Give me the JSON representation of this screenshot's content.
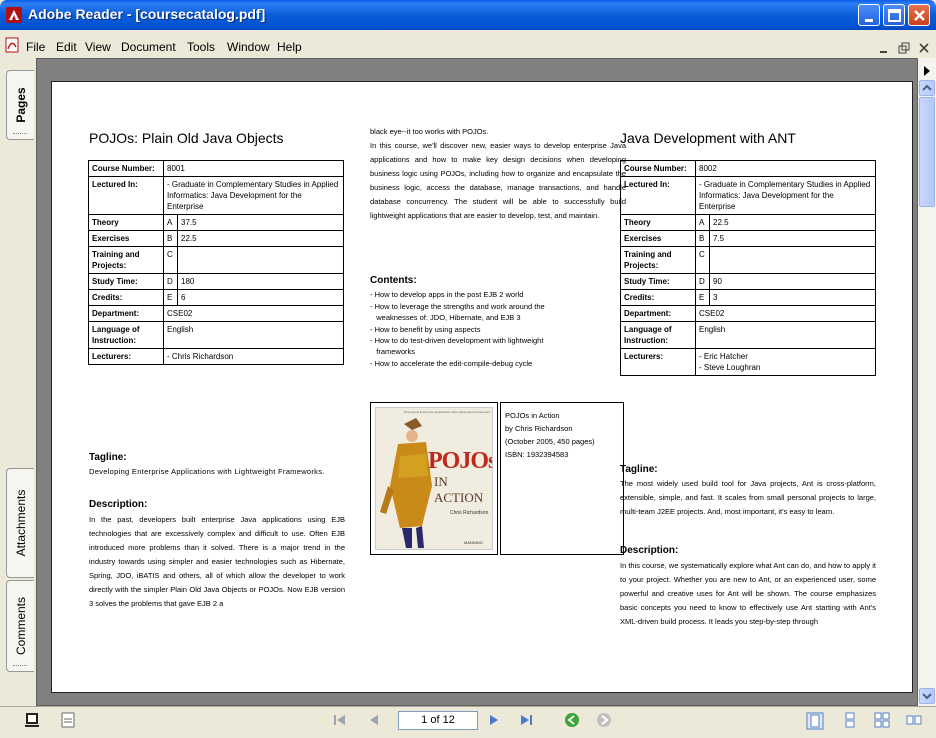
{
  "window": {
    "title": "Adobe Reader - [coursecatalog.pdf]"
  },
  "menu": [
    "File",
    "Edit",
    "View",
    "Document",
    "Tools",
    "Window",
    "Help"
  ],
  "side_tabs": {
    "pages": "Pages",
    "attachments": "Attachments",
    "comments": "Comments"
  },
  "doc": {
    "left": {
      "title": "POJOs: Plain Old Java Objects",
      "table": {
        "course_number_label": "Course Number:",
        "course_number": "8001",
        "lectured_in_label": "Lectured In:",
        "lectured_in": "- Graduate in Complementary Studies in Applied Informatics: Java Development for the Enterprise",
        "theory_label": "Theory",
        "theory_letter": "A",
        "theory_value": "37.5",
        "exercises_label": "Exercises",
        "exercises_letter": "B",
        "exercises_value": "22.5",
        "training_label": "Training and Projects:",
        "training_letter": "C",
        "training_value": "",
        "study_label": "Study Time:",
        "study_letter": "D",
        "study_value": "180",
        "credits_label": "Credits:",
        "credits_letter": "E",
        "credits_value": "6",
        "department_label": "Department:",
        "department": "CSE02",
        "language_label": "Language of Instruction:",
        "language": "English",
        "lecturers_label": "Lecturers:",
        "lecturers": "- Chris Richardson"
      },
      "tagline_h": "Tagline:",
      "tagline": "Developing Enterprise Applications with Lightweight Frameworks.",
      "description_h": "Description:",
      "description": "In the past, developers built enterprise Java applications using EJB technologies that are excessively complex and difficult to use. Often EJB introduced more problems than it solved. There is a major trend in the industry towards using simpler and easier technologies such as Hibernate, Spring, JDO, iBATIS and others, all of which allow the developer to work directly with the simpler Plain Old Java Objects or POJOs. Now EJB version 3 solves the problems that gave EJB 2 a"
    },
    "middle": {
      "continued": "black eye--it too works with POJOs.",
      "para": "In this course, we'll discover new, easier ways to develop enterprise Java applications and how to make key design decisions when developing business logic using POJOs, including how to organize and encapsulate the business logic, access the database, manage transactions, and handle database concurrency. The student will be able to successfully build lightweight applications that are easier to develop, test, and maintain.",
      "contents_h": "Contents:",
      "contents": [
        "- How to develop apps in the post EJB 2 world",
        "- How to leverage the strengths and work around the",
        "   weaknesses of: JDO, Hibernate, and EJB 3",
        "- How to benefit by using aspects",
        "- How to do test-driven development with lightweight",
        "   frameworks",
        "- How to accelerate the edit-compile-debug cycle"
      ],
      "book": {
        "cover_title": "POJOs",
        "cover_subtitle": "IN ACTION",
        "cover_author": "Chris Richardson",
        "cover_top": "Developing Enterprise Applications with Lightweight Frameworks",
        "cover_publisher": "MANNING",
        "line1": "POJOs in Action",
        "line2": "by Chris Richardson",
        "line3": "(October 2005, 450 pages)",
        "line4": "ISBN: 1932394583"
      }
    },
    "right": {
      "title": "Java Development with ANT",
      "table": {
        "course_number_label": "Course Number:",
        "course_number": "8002",
        "lectured_in_label": "Lectured In:",
        "lectured_in": "- Graduate in Complementary Studies in Applied Informatics: Java Development for the Enterprise",
        "theory_label": "Theory",
        "theory_letter": "A",
        "theory_value": "22.5",
        "exercises_label": "Exercises",
        "exercises_letter": "B",
        "exercises_value": "7.5",
        "training_label": "Training and Projects:",
        "training_letter": "C",
        "training_value": "",
        "study_label": "Study Time:",
        "study_letter": "D",
        "study_value": "90",
        "credits_label": "Credits:",
        "credits_letter": "E",
        "credits_value": "3",
        "department_label": "Department:",
        "department": "CSE02",
        "language_label": "Language of Instruction:",
        "language": "English",
        "lecturers_label": "Lecturers:",
        "lecturer_1": "- Eric Hatcher",
        "lecturer_2": "- Steve Loughran"
      },
      "tagline_h": "Tagline:",
      "tagline": "The most widely used build tool for Java projects, Ant is cross-platform, extensible, simple, and fast. It scales from small personal projects to large, multi-team J2EE projects. And, most important, it's easy to learn.",
      "description_h": "Description:",
      "description": "In this course, we systematically explore what Ant can do, and how to apply it to your project. Whether you are new to Ant, or an experienced user, some powerful and creative uses for Ant will be shown. The course emphasizes basic concepts you need to know to effectively use Ant starting with Ant's XML-driven build process. It leads you step-by-step through"
    }
  },
  "statusbar": {
    "page_indicator": "1 of 12"
  }
}
